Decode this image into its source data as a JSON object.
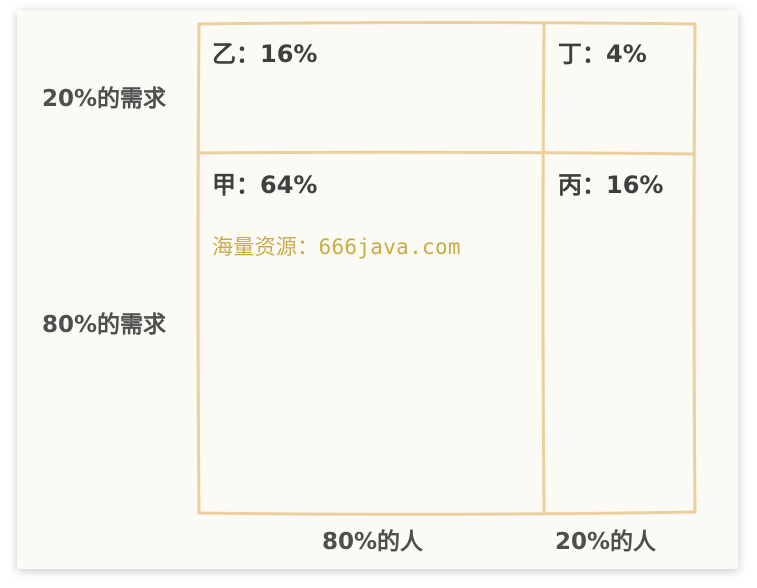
{
  "rows": {
    "top_label": "20%的需求",
    "bottom_label": "80%的需求"
  },
  "columns": {
    "left_label": "80%的人",
    "right_label": "20%的人"
  },
  "cells": {
    "top_left": "乙：16%",
    "top_right": "丁：4%",
    "bottom_left": "甲：64%",
    "bottom_right": "丙：16%"
  },
  "watermark": "海量资源：666java.com",
  "colors": {
    "grid_line": "#eccf9f",
    "text": "#4d4d4d",
    "watermark": "#c9ac44",
    "card_background": "#fbfaf5"
  }
}
